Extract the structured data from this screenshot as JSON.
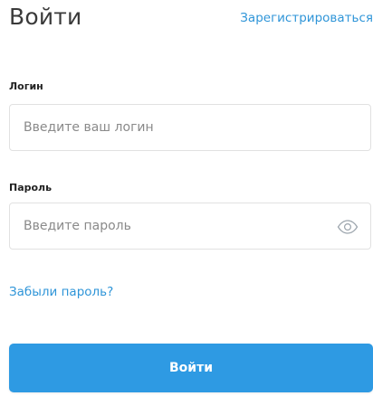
{
  "form": {
    "title": "Войти",
    "register_link": "Зарегистрироваться",
    "login": {
      "label": "Логин",
      "placeholder": "Введите ваш логин"
    },
    "password": {
      "label": "Пароль",
      "placeholder": "Введите пароль",
      "toggle_icon": "eye-icon"
    },
    "forgot_link": "Забыли пароль?",
    "submit_label": "Войти"
  },
  "colors": {
    "accent": "#2e9ae3",
    "link": "#2f95d8",
    "border": "#e1e1e1",
    "title_text": "#3a3a3a"
  }
}
